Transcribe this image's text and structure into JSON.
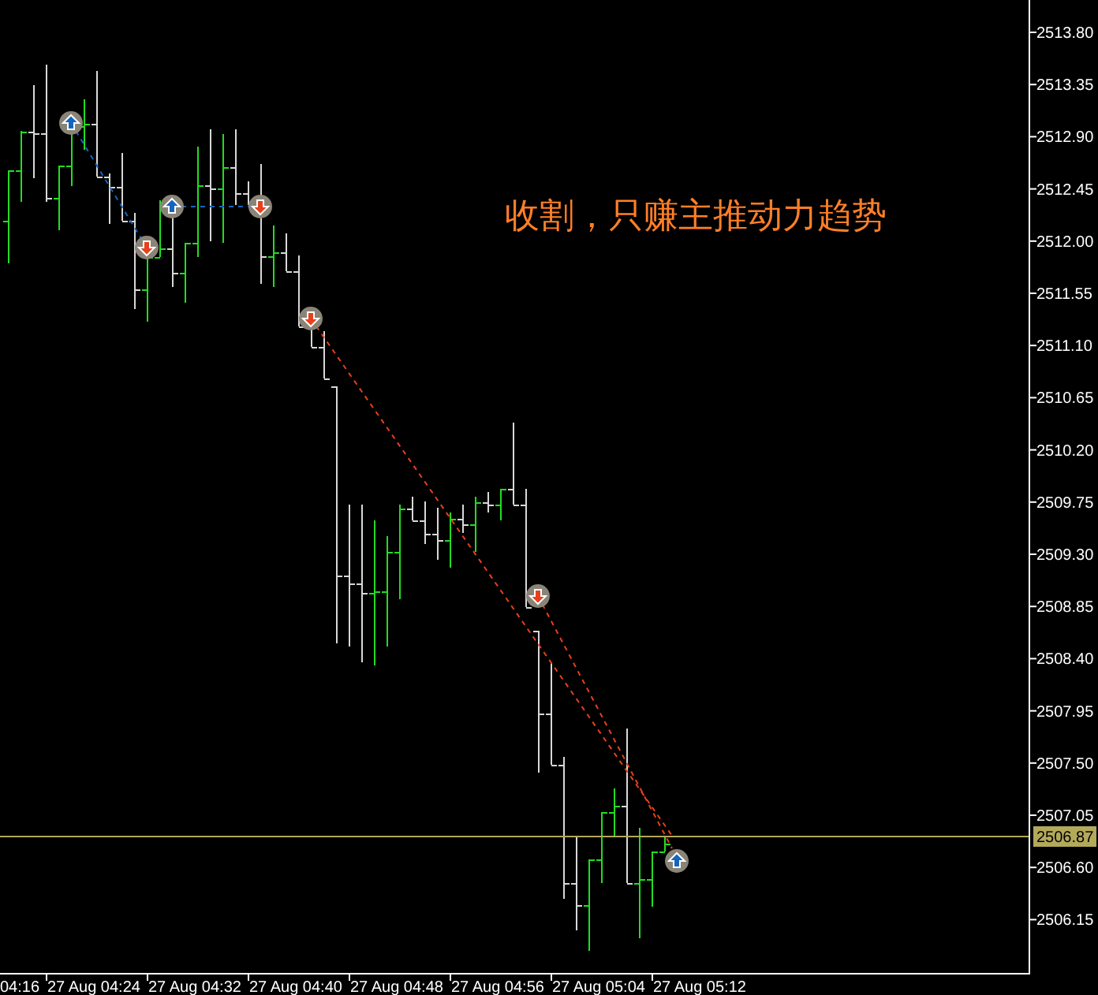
{
  "chart": {
    "annotation": "收割，只赚主推动力趋势",
    "price_labels": [
      "2513.80",
      "2513.35",
      "2512.90",
      "2512.45",
      "2512.00",
      "2511.55",
      "2511.10",
      "2510.65",
      "2510.20",
      "2509.75",
      "2509.30",
      "2508.85",
      "2508.40",
      "2507.95",
      "2507.50",
      "2507.05",
      "2506.60",
      "2506.15"
    ],
    "current_price": "2506.87",
    "time_labels": [
      "04:16",
      "27 Aug 04:24",
      "27 Aug 04:32",
      "27 Aug 04:40",
      "27 Aug 04:48",
      "27 Aug 04:56",
      "27 Aug 05:04",
      "27 Aug 05:12"
    ]
  }
}
